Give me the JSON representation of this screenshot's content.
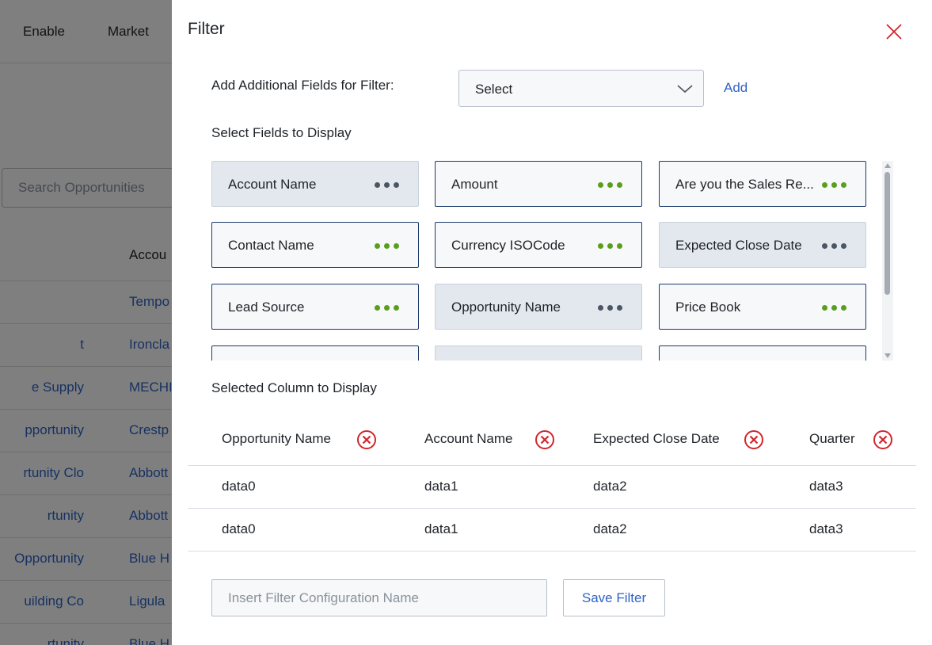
{
  "background": {
    "nav": [
      "Enable",
      "Market"
    ],
    "search_placeholder": "Search Opportunities",
    "column_header": "Accou",
    "rows": [
      {
        "name": "",
        "account": "Tempo"
      },
      {
        "name": "t",
        "account": "Ironcla"
      },
      {
        "name": "e Supply",
        "account": "MECHI"
      },
      {
        "name": "pportunity",
        "account": "Crestp"
      },
      {
        "name": "rtunity Clo",
        "account": "Abbott"
      },
      {
        "name": "rtunity",
        "account": "Abbott"
      },
      {
        "name": " Opportunity",
        "account": "Blue H"
      },
      {
        "name": "uilding Co",
        "account": "Ligula"
      },
      {
        "name": "rtunity",
        "account": "Blue H"
      }
    ]
  },
  "drawer": {
    "title": "Filter",
    "add_fields_label": "Add Additional Fields for Filter:",
    "select_value": "Select",
    "add_label": "Add",
    "select_fields_label": "Select Fields to Display",
    "fields": [
      {
        "label": "Account Name",
        "selected": true
      },
      {
        "label": "Amount",
        "selected": false
      },
      {
        "label": "Are you the Sales Re...",
        "selected": false
      },
      {
        "label": "Contact Name",
        "selected": false
      },
      {
        "label": "Currency ISOCode",
        "selected": false
      },
      {
        "label": "Expected Close Date",
        "selected": true
      },
      {
        "label": "Lead Source",
        "selected": false
      },
      {
        "label": "Opportunity Name",
        "selected": true
      },
      {
        "label": "Price Book",
        "selected": false
      },
      {
        "label": "",
        "selected": false
      },
      {
        "label": "",
        "selected": true
      },
      {
        "label": "",
        "selected": false
      }
    ],
    "selected_columns_label": "Selected Column to Display",
    "columns": [
      "Opportunity Name",
      "Account Name",
      "Expected Close Date",
      "Quarter"
    ],
    "rows": [
      [
        "data0",
        "data1",
        "data2",
        "data3"
      ],
      [
        "data0",
        "data1",
        "data2",
        "data3"
      ]
    ],
    "config_placeholder": "Insert Filter Configuration Name",
    "save_label": "Save Filter"
  },
  "colors": {
    "accent": "#2f63c4",
    "dots_active": "#5a9e1b",
    "dots_selected": "#4b5563",
    "remove_icon": "#d0262c",
    "close_icon": "#d0262c"
  }
}
